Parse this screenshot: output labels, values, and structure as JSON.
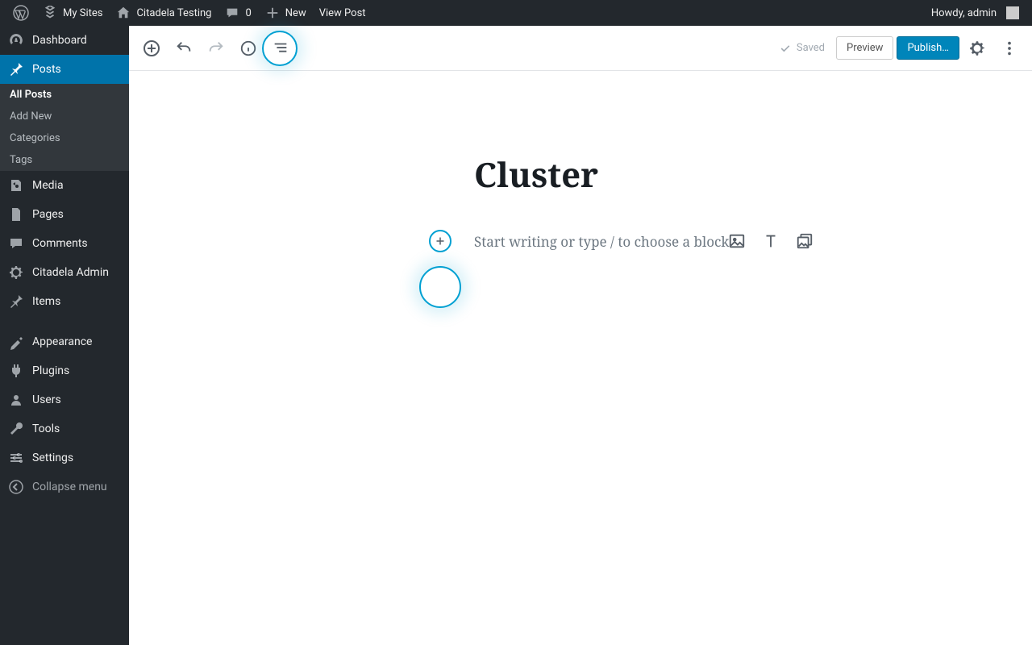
{
  "adminbar": {
    "my_sites": "My Sites",
    "site_name": "Citadela Testing",
    "comments_count": "0",
    "new": "New",
    "view_post": "View Post",
    "howdy": "Howdy, admin"
  },
  "sidebar": {
    "dashboard": "Dashboard",
    "posts": "Posts",
    "posts_submenu": {
      "all_posts": "All Posts",
      "add_new": "Add New",
      "categories": "Categories",
      "tags": "Tags"
    },
    "media": "Media",
    "pages": "Pages",
    "comments": "Comments",
    "citadela_admin": "Citadela Admin",
    "items": "Items",
    "appearance": "Appearance",
    "plugins": "Plugins",
    "users": "Users",
    "tools": "Tools",
    "settings": "Settings",
    "collapse": "Collapse menu"
  },
  "editor": {
    "saved": "Saved",
    "preview": "Preview",
    "publish": "Publish…",
    "post_title": "Cluster",
    "placeholder": "Start writing or type / to choose a block"
  }
}
